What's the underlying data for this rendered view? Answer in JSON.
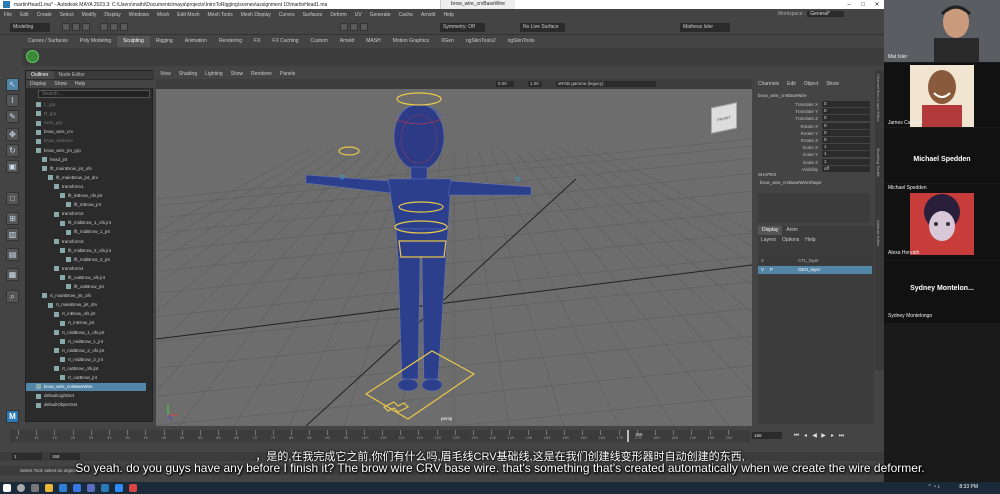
{
  "window": {
    "title": "martinHead1.ma* - Autodesk MAYA 2023.3: C:\\Users\\mathi\\Documents\\maya\\projects\\IntroToRigging\\scenes\\assignment 10\\martinHead1.ma",
    "tabs": [
      "brow_wire_crvBaseWire"
    ],
    "min": "–",
    "max": "□",
    "close": "✕"
  },
  "menubar": [
    "File",
    "Edit",
    "Create",
    "Select",
    "Modify",
    "Display",
    "Windows",
    "Mesh",
    "Edit Mesh",
    "Mesh Tools",
    "Mesh Display",
    "Curves",
    "Surfaces",
    "Deform",
    "UV",
    "Generate",
    "Cache",
    "Arnold",
    "Help"
  ],
  "workspace": {
    "label": "Workspace :",
    "value": "General*"
  },
  "status": {
    "mode": "Modeling",
    "symmetry": "Symmetry: Off",
    "live": "No Live Surface",
    "user": "Matheus Isler"
  },
  "shelf": {
    "tabs": [
      "Curves / Surfaces",
      "Poly Modeling",
      "Sculpting",
      "Rigging",
      "Animation",
      "Rendering",
      "FX",
      "FX Caching",
      "Custom",
      "Arnold",
      "MASH",
      "Motion Graphics",
      "XGen",
      "ngSkinTools2",
      "ngSkinTools"
    ],
    "active": "Sculpting"
  },
  "outliner": {
    "tabs": [
      "Outliner",
      "Node Editor"
    ],
    "menu": [
      "Display",
      "Show",
      "Help"
    ],
    "search": "Search...",
    "items": [
      {
        "label": "L_grp",
        "indent": 1,
        "dim": true
      },
      {
        "label": "R_grp",
        "indent": 1,
        "dim": true
      },
      {
        "label": "neck_grp",
        "indent": 1,
        "dim": true
      },
      {
        "label": "brow_wire_crv",
        "indent": 1
      },
      {
        "label": "brow_skeleton",
        "indent": 1,
        "dim": true
      },
      {
        "label": "brow_wire_jnt_grp",
        "indent": 1
      },
      {
        "label": "head_jnt",
        "indent": 2
      },
      {
        "label": "lft_mainBrow_jnt_ofs",
        "indent": 2
      },
      {
        "label": "lft_mainBrow_jnt_drv",
        "indent": 3
      },
      {
        "label": "transform1",
        "indent": 4
      },
      {
        "label": "lft_inBrow_ofs.jnt",
        "indent": 5
      },
      {
        "label": "lft_inBrow_jnt",
        "indent": 6
      },
      {
        "label": "transform2",
        "indent": 4
      },
      {
        "label": "lft_midBrow_1_ofs.jnt",
        "indent": 5
      },
      {
        "label": "lft_midBrow_1_jnt",
        "indent": 6
      },
      {
        "label": "transform3",
        "indent": 4
      },
      {
        "label": "lft_midBrow_2_ofs.jnt",
        "indent": 5
      },
      {
        "label": "lft_midBrow_2_jnt",
        "indent": 6
      },
      {
        "label": "transform4",
        "indent": 4
      },
      {
        "label": "lft_outBrow_ofs.jnt",
        "indent": 5
      },
      {
        "label": "lft_outBrow_jnt",
        "indent": 6
      },
      {
        "label": "rt_mainBrow_jnt_ofs",
        "indent": 2
      },
      {
        "label": "rt_mainBrow_jnt_drv",
        "indent": 3
      },
      {
        "label": "rt_inBrow_ofs.jnt",
        "indent": 4
      },
      {
        "label": "rt_inBrow_jnt",
        "indent": 5
      },
      {
        "label": "rt_midBrow_1_ofs.jnt",
        "indent": 4
      },
      {
        "label": "rt_midBrow_1_jnt",
        "indent": 5
      },
      {
        "label": "rt_midBrow_2_ofs.jnt",
        "indent": 4
      },
      {
        "label": "rt_midBrow_2_jnt",
        "indent": 5
      },
      {
        "label": "rt_outBrow_ofs.jnt",
        "indent": 4
      },
      {
        "label": "rt_outBrow_jnt",
        "indent": 5
      },
      {
        "label": "brow_wire_crvBaseWire",
        "indent": 1,
        "selected": true
      },
      {
        "label": "defaultLightSet",
        "indent": 1
      },
      {
        "label": "defaultObjectSet",
        "indent": 1
      }
    ]
  },
  "viewport": {
    "menu": [
      "View",
      "Shading",
      "Lighting",
      "Show",
      "Renderer",
      "Panels"
    ],
    "field1": "0.00",
    "field2": "1.00",
    "colorspace": "sRGB gamma (legacy)",
    "camera": "persp",
    "cube": "FRONT"
  },
  "channelbox": {
    "menu": [
      "Channels",
      "Edit",
      "Object",
      "Show"
    ],
    "node": "brow_wire_crvBaseWire",
    "attrs": [
      {
        "k": "Translate X",
        "v": "0"
      },
      {
        "k": "Translate Y",
        "v": "0"
      },
      {
        "k": "Translate Z",
        "v": "0"
      },
      {
        "k": "Rotate X",
        "v": "0"
      },
      {
        "k": "Rotate Y",
        "v": "0"
      },
      {
        "k": "Rotate Z",
        "v": "0"
      },
      {
        "k": "Scale X",
        "v": "1"
      },
      {
        "k": "Scale Y",
        "v": "1"
      },
      {
        "k": "Scale Z",
        "v": "1"
      },
      {
        "k": "Visibility",
        "v": "off"
      }
    ],
    "shapes_label": "SHAPES",
    "shape": "brow_wire_crvBaseWireShape"
  },
  "layers": {
    "tabs": [
      "Display",
      "Anim"
    ],
    "menu": [
      "Layers",
      "Options",
      "Help"
    ],
    "rows": [
      {
        "v": "V",
        "p": "",
        "name": "CTL_layer"
      },
      {
        "v": "V",
        "p": "P",
        "name": "GEO_layer",
        "selected": true
      }
    ]
  },
  "sidestrip": [
    "Channel Box / Layer Editor",
    "Modeling Toolkit",
    "Attribute Editor"
  ],
  "timeline": {
    "ticks": [
      "5",
      "10",
      "15",
      "20",
      "25",
      "30",
      "35",
      "40",
      "45",
      "50",
      "55",
      "60",
      "65",
      "70",
      "75",
      "80",
      "85",
      "90",
      "95",
      "100",
      "105",
      "110",
      "115",
      "120",
      "125",
      "130",
      "135",
      "140",
      "145",
      "150",
      "155",
      "160",
      "165",
      "170",
      "175",
      "180",
      "185",
      "190",
      "195",
      "200"
    ],
    "current": "168",
    "start": "1",
    "end": "168"
  },
  "helpline": "Select Tool: select an object",
  "subtitle_cn": "，是的,在我完成它之前,你们有什么吗,眉毛线CRV基础线,这是在我们创建线变形器时自动创建的东西,",
  "subtitle_en": "So yeah. do you guys have any before I finish it? The brow wire CRV base wire. that's something that's created automatically when we create the wire deformer.",
  "taskbar": {
    "time": "8:33 PM"
  },
  "participants": [
    {
      "name": "Mat Isler"
    },
    {
      "name": "James Cabuloy"
    },
    {
      "name": "Michael Spedden",
      "big": "Michael Spedden"
    },
    {
      "name": "Alexa Horvath"
    },
    {
      "name": "Sydney Montelongo",
      "big": "Sydney  Montelon..."
    }
  ]
}
